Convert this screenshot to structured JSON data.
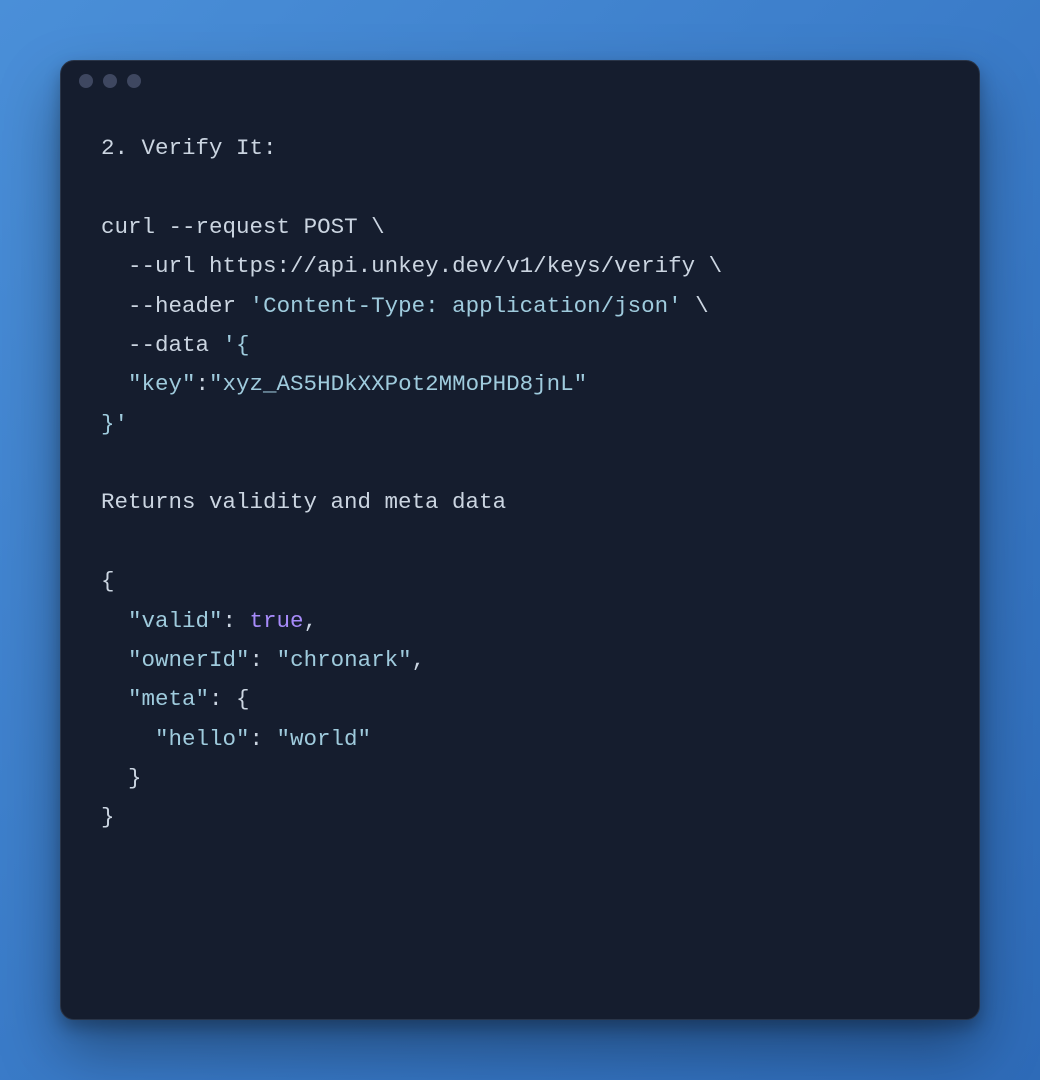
{
  "heading": "2. Verify It:",
  "curl": {
    "cmd": "curl",
    "flag_request": "--request",
    "method": "POST",
    "flag_url": "--url",
    "url": "https://api.unkey.dev/v1/keys/verify",
    "flag_header": "--header",
    "header": "'Content-Type: application/json'",
    "flag_data": "--data",
    "data_open": "'{",
    "data_key_label": "\"key\"",
    "data_key_value": "\"xyz_AS5HDkXXPot2MMoPHD8jnL\"",
    "data_close": "}'"
  },
  "response_caption": "Returns validity and meta data",
  "response": {
    "valid_key": "\"valid\"",
    "valid_value": "true",
    "owner_key": "\"ownerId\"",
    "owner_value": "\"chronark\"",
    "meta_key": "\"meta\"",
    "hello_key": "\"hello\"",
    "hello_value": "\"world\""
  }
}
